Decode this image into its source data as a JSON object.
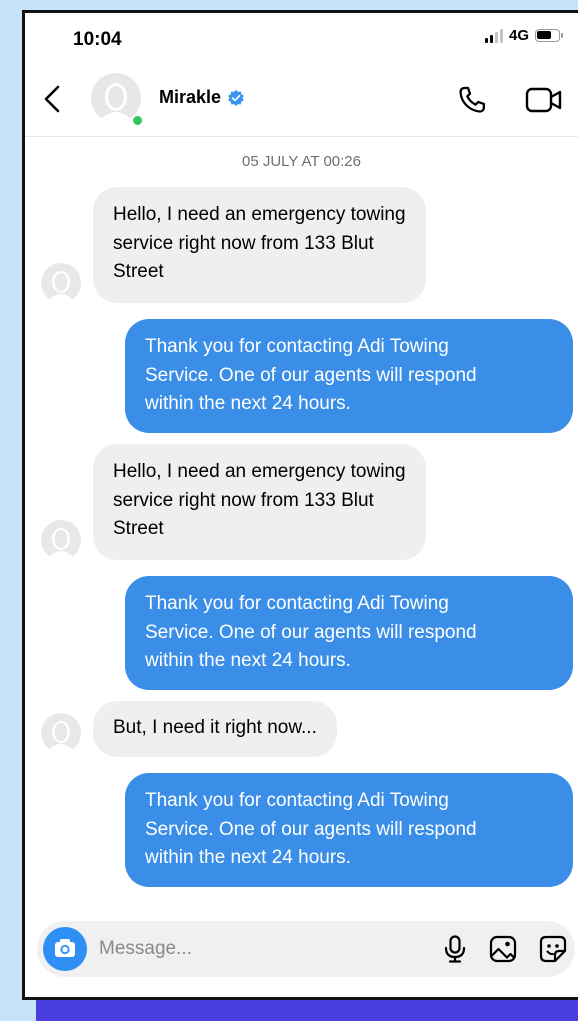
{
  "status_bar": {
    "time": "10:04",
    "network": "4G"
  },
  "header": {
    "contact_name": "Mirakle"
  },
  "conversation": {
    "timestamp": "05 JULY AT 00:26",
    "messages": [
      {
        "direction": "in",
        "lines": [
          "Hello, I need an emergency towing",
          "service right now from 133 Blut",
          "Street"
        ]
      },
      {
        "direction": "out",
        "lines": [
          "Thank you for contacting Adi Towing",
          "Service. One of our agents will respond",
          "within the next 24 hours."
        ]
      },
      {
        "direction": "in",
        "lines": [
          "Hello, I need an emergency towing",
          "service right now from 133 Blut",
          "Street"
        ]
      },
      {
        "direction": "out",
        "lines": [
          "Thank you for contacting Adi Towing",
          "Service. One of our agents will respond",
          "within the next 24 hours."
        ]
      },
      {
        "direction": "in",
        "lines": [
          "But, I need it right now..."
        ]
      },
      {
        "direction": "out",
        "lines": [
          "Thank you for contacting Adi Towing",
          "Service. One of our agents will respond",
          "within the next 24 hours."
        ]
      }
    ]
  },
  "composer": {
    "placeholder": "Message..."
  },
  "colors": {
    "outgoing_bubble": "#3a8ee8",
    "incoming_bubble": "#efefef",
    "camera_button": "#2f8ff4",
    "verified_badge": "#3897f0",
    "online_dot": "#34c759"
  },
  "icons": [
    "back-arrow-icon",
    "verified-badge-icon",
    "phone-icon",
    "video-camera-icon",
    "camera-icon",
    "microphone-icon",
    "image-icon",
    "sticker-icon"
  ]
}
